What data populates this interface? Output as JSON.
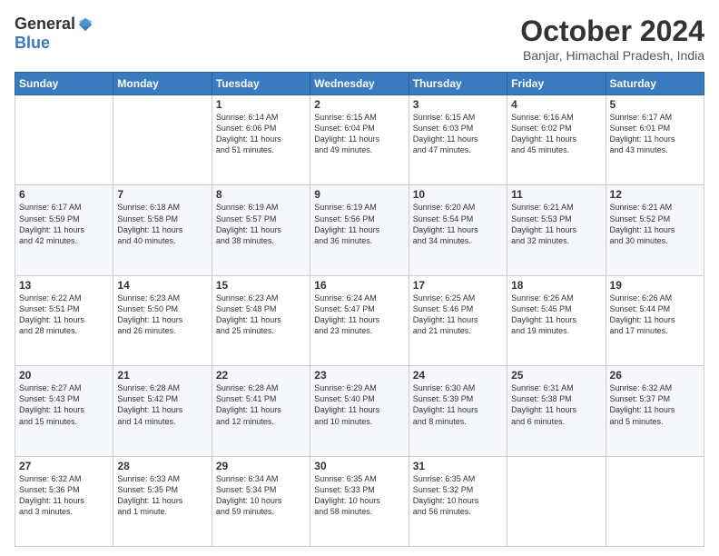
{
  "logo": {
    "general": "General",
    "blue": "Blue"
  },
  "header": {
    "month_title": "October 2024",
    "location": "Banjar, Himachal Pradesh, India"
  },
  "weekdays": [
    "Sunday",
    "Monday",
    "Tuesday",
    "Wednesday",
    "Thursday",
    "Friday",
    "Saturday"
  ],
  "weeks": [
    [
      {
        "day": "",
        "info": ""
      },
      {
        "day": "",
        "info": ""
      },
      {
        "day": "1",
        "info": "Sunrise: 6:14 AM\nSunset: 6:06 PM\nDaylight: 11 hours\nand 51 minutes."
      },
      {
        "day": "2",
        "info": "Sunrise: 6:15 AM\nSunset: 6:04 PM\nDaylight: 11 hours\nand 49 minutes."
      },
      {
        "day": "3",
        "info": "Sunrise: 6:15 AM\nSunset: 6:03 PM\nDaylight: 11 hours\nand 47 minutes."
      },
      {
        "day": "4",
        "info": "Sunrise: 6:16 AM\nSunset: 6:02 PM\nDaylight: 11 hours\nand 45 minutes."
      },
      {
        "day": "5",
        "info": "Sunrise: 6:17 AM\nSunset: 6:01 PM\nDaylight: 11 hours\nand 43 minutes."
      }
    ],
    [
      {
        "day": "6",
        "info": "Sunrise: 6:17 AM\nSunset: 5:59 PM\nDaylight: 11 hours\nand 42 minutes."
      },
      {
        "day": "7",
        "info": "Sunrise: 6:18 AM\nSunset: 5:58 PM\nDaylight: 11 hours\nand 40 minutes."
      },
      {
        "day": "8",
        "info": "Sunrise: 6:19 AM\nSunset: 5:57 PM\nDaylight: 11 hours\nand 38 minutes."
      },
      {
        "day": "9",
        "info": "Sunrise: 6:19 AM\nSunset: 5:56 PM\nDaylight: 11 hours\nand 36 minutes."
      },
      {
        "day": "10",
        "info": "Sunrise: 6:20 AM\nSunset: 5:54 PM\nDaylight: 11 hours\nand 34 minutes."
      },
      {
        "day": "11",
        "info": "Sunrise: 6:21 AM\nSunset: 5:53 PM\nDaylight: 11 hours\nand 32 minutes."
      },
      {
        "day": "12",
        "info": "Sunrise: 6:21 AM\nSunset: 5:52 PM\nDaylight: 11 hours\nand 30 minutes."
      }
    ],
    [
      {
        "day": "13",
        "info": "Sunrise: 6:22 AM\nSunset: 5:51 PM\nDaylight: 11 hours\nand 28 minutes."
      },
      {
        "day": "14",
        "info": "Sunrise: 6:23 AM\nSunset: 5:50 PM\nDaylight: 11 hours\nand 26 minutes."
      },
      {
        "day": "15",
        "info": "Sunrise: 6:23 AM\nSunset: 5:48 PM\nDaylight: 11 hours\nand 25 minutes."
      },
      {
        "day": "16",
        "info": "Sunrise: 6:24 AM\nSunset: 5:47 PM\nDaylight: 11 hours\nand 23 minutes."
      },
      {
        "day": "17",
        "info": "Sunrise: 6:25 AM\nSunset: 5:46 PM\nDaylight: 11 hours\nand 21 minutes."
      },
      {
        "day": "18",
        "info": "Sunrise: 6:26 AM\nSunset: 5:45 PM\nDaylight: 11 hours\nand 19 minutes."
      },
      {
        "day": "19",
        "info": "Sunrise: 6:26 AM\nSunset: 5:44 PM\nDaylight: 11 hours\nand 17 minutes."
      }
    ],
    [
      {
        "day": "20",
        "info": "Sunrise: 6:27 AM\nSunset: 5:43 PM\nDaylight: 11 hours\nand 15 minutes."
      },
      {
        "day": "21",
        "info": "Sunrise: 6:28 AM\nSunset: 5:42 PM\nDaylight: 11 hours\nand 14 minutes."
      },
      {
        "day": "22",
        "info": "Sunrise: 6:28 AM\nSunset: 5:41 PM\nDaylight: 11 hours\nand 12 minutes."
      },
      {
        "day": "23",
        "info": "Sunrise: 6:29 AM\nSunset: 5:40 PM\nDaylight: 11 hours\nand 10 minutes."
      },
      {
        "day": "24",
        "info": "Sunrise: 6:30 AM\nSunset: 5:39 PM\nDaylight: 11 hours\nand 8 minutes."
      },
      {
        "day": "25",
        "info": "Sunrise: 6:31 AM\nSunset: 5:38 PM\nDaylight: 11 hours\nand 6 minutes."
      },
      {
        "day": "26",
        "info": "Sunrise: 6:32 AM\nSunset: 5:37 PM\nDaylight: 11 hours\nand 5 minutes."
      }
    ],
    [
      {
        "day": "27",
        "info": "Sunrise: 6:32 AM\nSunset: 5:36 PM\nDaylight: 11 hours\nand 3 minutes."
      },
      {
        "day": "28",
        "info": "Sunrise: 6:33 AM\nSunset: 5:35 PM\nDaylight: 11 hours\nand 1 minute."
      },
      {
        "day": "29",
        "info": "Sunrise: 6:34 AM\nSunset: 5:34 PM\nDaylight: 10 hours\nand 59 minutes."
      },
      {
        "day": "30",
        "info": "Sunrise: 6:35 AM\nSunset: 5:33 PM\nDaylight: 10 hours\nand 58 minutes."
      },
      {
        "day": "31",
        "info": "Sunrise: 6:35 AM\nSunset: 5:32 PM\nDaylight: 10 hours\nand 56 minutes."
      },
      {
        "day": "",
        "info": ""
      },
      {
        "day": "",
        "info": ""
      }
    ]
  ]
}
